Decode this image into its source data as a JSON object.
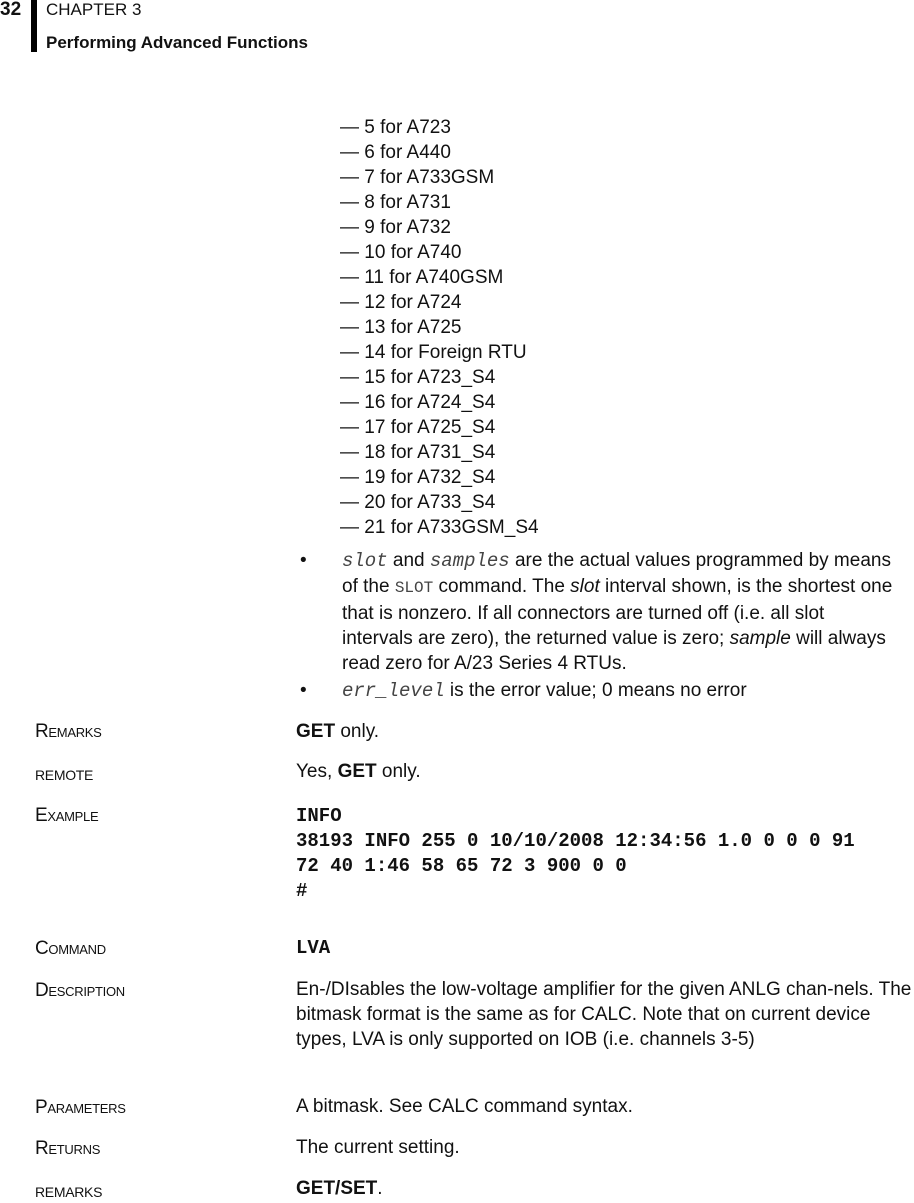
{
  "header": {
    "page_number": "32",
    "chapter": "CHAPTER 3",
    "section": "Performing Advanced Functions"
  },
  "device_list": [
    "— 5 for A723",
    "— 6 for A440",
    "— 7 for A733GSM",
    "— 8 for A731",
    "— 9 for A732",
    "— 10 for A740",
    "— 11 for A740GSM",
    "— 12 for A724",
    "— 13 for A725",
    "— 14 for Foreign RTU",
    "— 15 for A723_S4",
    "— 16 for A724_S4",
    "— 17 for A725_S4",
    "— 18 for A731_S4",
    "— 19 for A732_S4",
    "— 20 for A733_S4",
    "— 21 for A733GSM_S4"
  ],
  "bullets": {
    "slot": {
      "code1": "slot",
      "and": " and ",
      "code2": "samples",
      "t1": " are the actual values programmed by means of the ",
      "code3": "SLOT",
      "t2": " command. The ",
      "em1": "slot",
      "t3": " interval shown, is the shortest one that is nonzero. If all connectors are turned off (i.e. all slot intervals are zero), the returned value is zero; ",
      "em2": "sample",
      "t4": " will always read zero for A/23 Series 4 RTUs."
    },
    "err": {
      "code": "err_level",
      "text": " is the error value; 0 means no error"
    }
  },
  "info_entry": {
    "remarks_label": "Remarks",
    "remarks_bold": "GET",
    "remarks_text": " only.",
    "remote_label": "REMOTE",
    "remote_pre": "Yes, ",
    "remote_bold": "GET",
    "remote_text": " only.",
    "example_label": "Example",
    "example_lines": [
      "INFO",
      "38193 INFO 255 0 10/10/2008 12:34:56 1.0 0 0 0 91",
      "72 40 1:46 58 65 72 3 900 0 0",
      "#"
    ]
  },
  "lva_entry": {
    "command_label": "Command",
    "command": "LVA",
    "description_label": "Description",
    "description": "En-/DIsables the low-voltage amplifier for the given ANLG chan-nels. The bitmask format is the same as for CALC. Note that on current device types, LVA is only supported on IOB (i.e. channels 3-5)",
    "parameters_label": "Parameters",
    "parameters": "A bitmask. See CALC command syntax.",
    "returns_label": "Returns",
    "returns": "The current setting.",
    "remarks_label": "REMARKS",
    "remarks_bold": "GET/SET",
    "remarks_text": "."
  }
}
